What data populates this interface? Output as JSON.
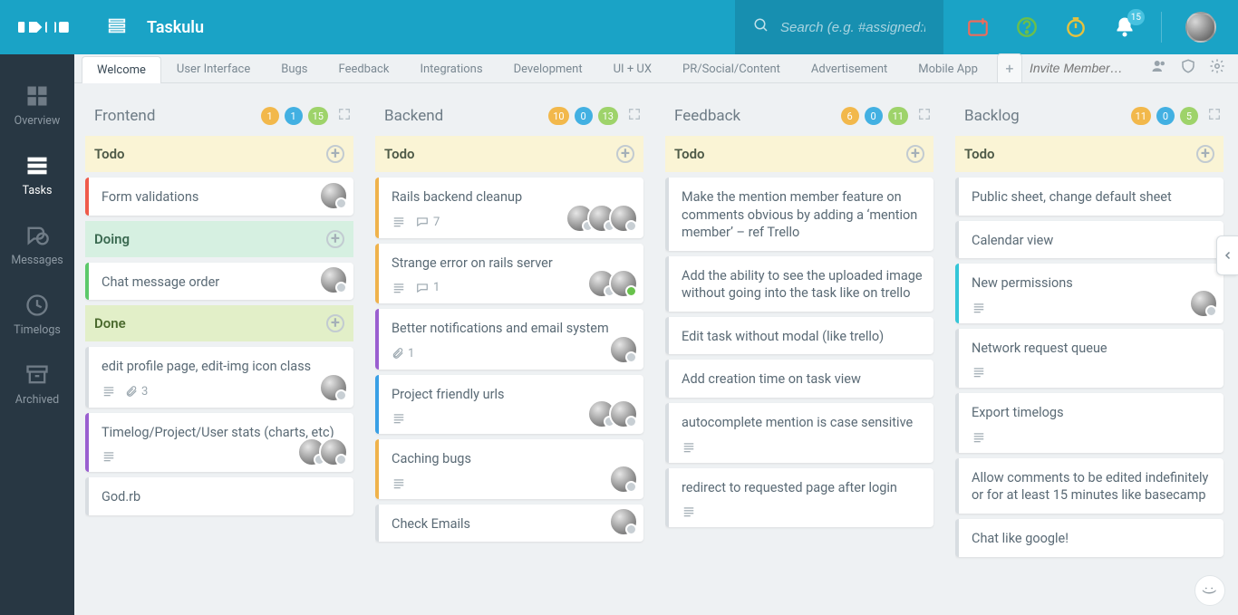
{
  "app_title": "Taskulu",
  "search_placeholder": "Search (e.g. #assigned:me",
  "notifications_count": "15",
  "invite_placeholder": "Invite Member…",
  "tabs": [
    {
      "label": "Welcome",
      "active": true
    },
    {
      "label": "User Interface"
    },
    {
      "label": "Bugs"
    },
    {
      "label": "Feedback"
    },
    {
      "label": "Integrations"
    },
    {
      "label": "Development"
    },
    {
      "label": "UI + UX"
    },
    {
      "label": "PR/Social/Content"
    },
    {
      "label": "Advertisement"
    },
    {
      "label": "Mobile App"
    }
  ],
  "leftnav": [
    {
      "label": "Overview",
      "icon": "grid"
    },
    {
      "label": "Tasks",
      "icon": "stack",
      "active": true
    },
    {
      "label": "Messages",
      "icon": "chat"
    },
    {
      "label": "Timelogs",
      "icon": "clock"
    },
    {
      "label": "Archived",
      "icon": "archive"
    }
  ],
  "lists": [
    {
      "title": "Frontend",
      "counts": {
        "yellow": "1",
        "blue": "1",
        "green": "15"
      },
      "sections": [
        {
          "name": "Todo",
          "style": "todo",
          "cards": [
            {
              "title": "Form validations",
              "stripe": "red",
              "avatars": 1
            }
          ]
        },
        {
          "name": "Doing",
          "style": "doing",
          "cards": [
            {
              "title": "Chat message order",
              "stripe": "green",
              "avatars": 1
            }
          ]
        },
        {
          "name": "Done",
          "style": "done",
          "cards": [
            {
              "title": "edit profile page, edit-img icon class",
              "stripe": "grey",
              "desc": true,
              "attach": "3",
              "avatars": 1
            },
            {
              "title": "Timelog/Project/User stats (charts, etc)",
              "stripe": "purple",
              "desc": true,
              "avatars": 2
            },
            {
              "title": "God.rb",
              "stripe": "grey"
            }
          ]
        }
      ]
    },
    {
      "title": "Backend",
      "counts": {
        "yellow": "10",
        "blue": "0",
        "green": "13"
      },
      "sections": [
        {
          "name": "Todo",
          "style": "todo",
          "cards": [
            {
              "title": "Rails backend cleanup",
              "stripe": "orange",
              "desc": true,
              "comments": "7",
              "avatars": 3
            },
            {
              "title": "Strange error on rails server",
              "stripe": "orange",
              "desc": true,
              "comments": "1",
              "avatars": 2,
              "last_online": true
            },
            {
              "title": "Better notifications and email system",
              "stripe": "purple",
              "attach": "1",
              "avatars": 1
            },
            {
              "title": "Project friendly urls",
              "stripe": "blue",
              "desc": true,
              "avatars": 2
            },
            {
              "title": "Caching bugs",
              "stripe": "orange",
              "desc": true,
              "avatars": 1
            },
            {
              "title": "Check Emails",
              "stripe": "grey",
              "avatars": 1
            }
          ]
        }
      ]
    },
    {
      "title": "Feedback",
      "counts": {
        "yellow": "6",
        "blue": "0",
        "green": "11"
      },
      "sections": [
        {
          "name": "Todo",
          "style": "todo",
          "cards": [
            {
              "title": "Make the mention member feature on comments obvious by adding a ‘mention member’ – ref Trello",
              "stripe": "grey"
            },
            {
              "title": "Add the ability to see the uploaded image without going into the task like on trello",
              "stripe": "grey"
            },
            {
              "title": "Edit task without modal (like trello)",
              "stripe": "grey"
            },
            {
              "title": "Add creation time on task view",
              "stripe": "grey"
            },
            {
              "title": "autocomplete mention is case sensitive",
              "stripe": "grey",
              "desc": true
            },
            {
              "title": "redirect to requested page after login",
              "stripe": "grey",
              "desc": true
            }
          ]
        }
      ]
    },
    {
      "title": "Backlog",
      "counts": {
        "yellow": "11",
        "blue": "0",
        "green": "5"
      },
      "sections": [
        {
          "name": "Todo",
          "style": "todo",
          "cards": [
            {
              "title": "Public sheet, change default sheet",
              "stripe": "grey"
            },
            {
              "title": "Calendar view",
              "stripe": "grey"
            },
            {
              "title": "New permissions",
              "stripe": "cyan",
              "desc": true,
              "avatars": 1
            },
            {
              "title": "Network request queue",
              "stripe": "grey",
              "desc": true
            },
            {
              "title": "Export timelogs",
              "stripe": "grey",
              "desc": true
            },
            {
              "title": "Allow comments to be edited indefinitely or for at least 15 minutes like basecamp",
              "stripe": "grey"
            },
            {
              "title": "Chat like google!",
              "stripe": "grey"
            }
          ]
        }
      ]
    }
  ]
}
